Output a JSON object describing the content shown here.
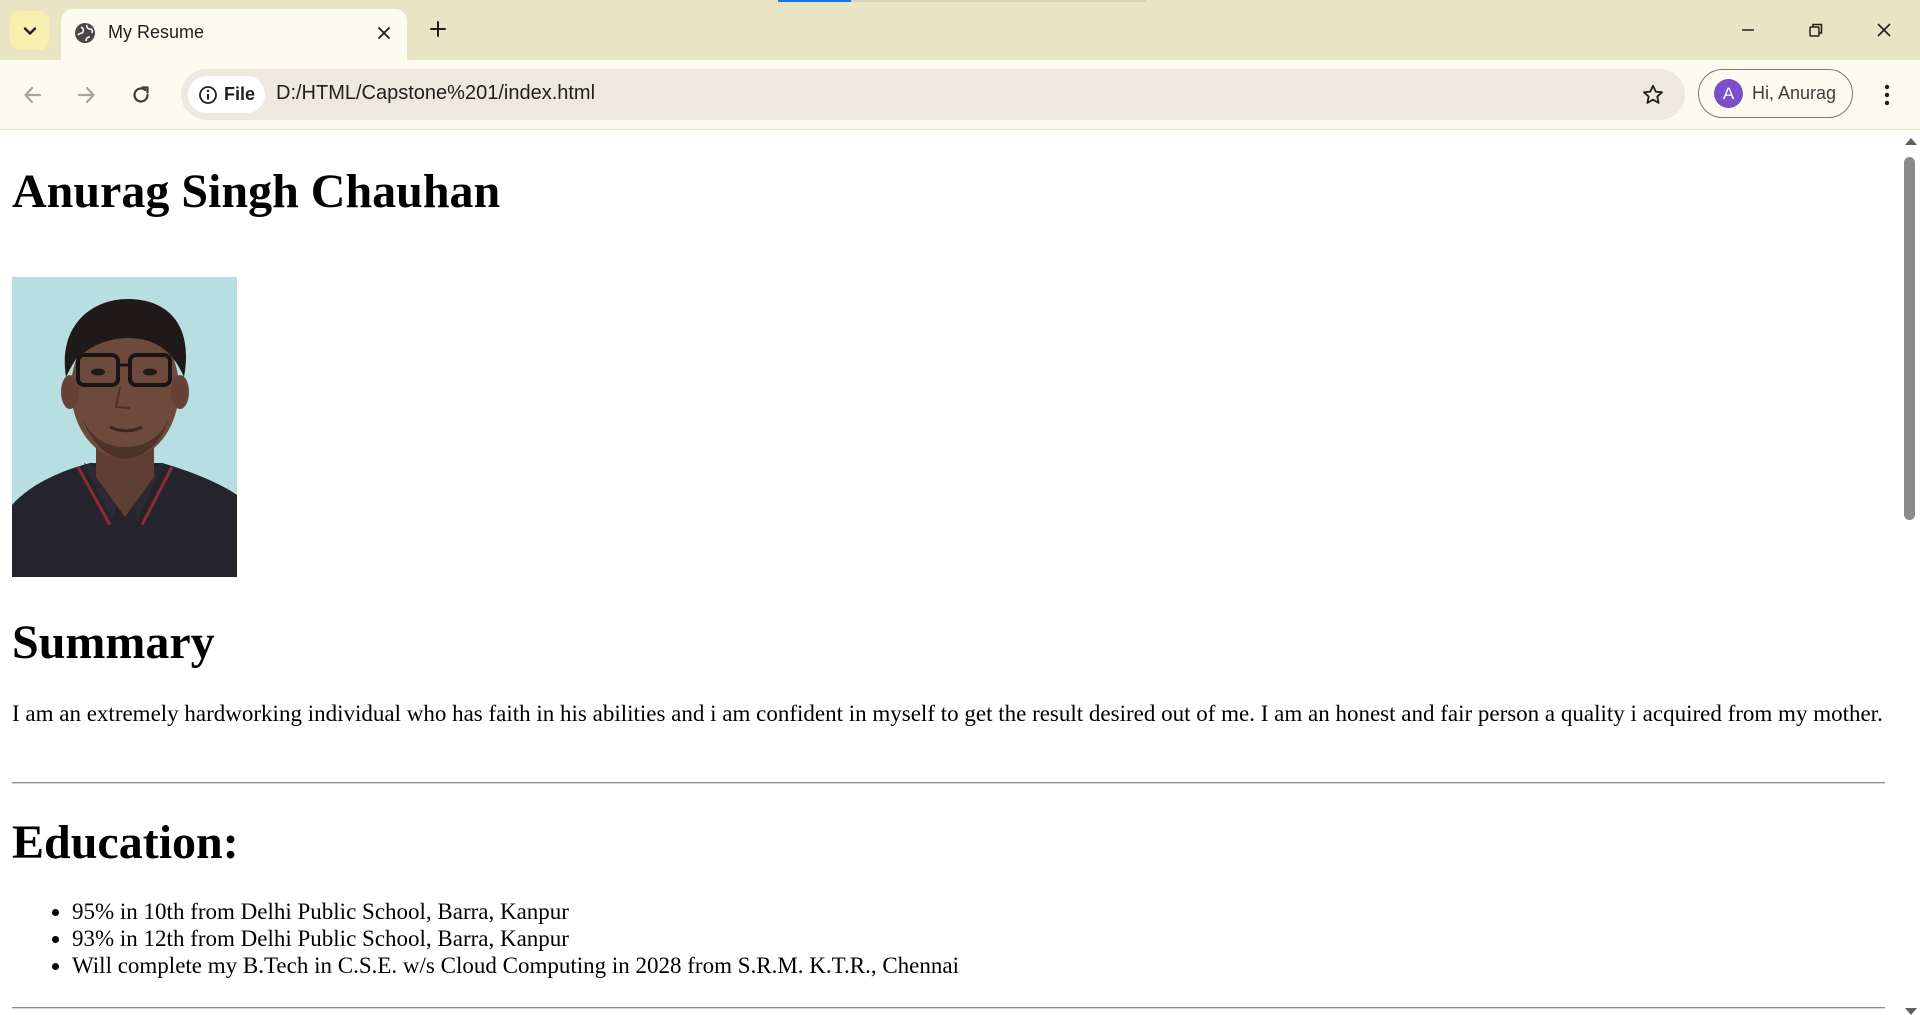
{
  "browser": {
    "tab": {
      "title": "My Resume",
      "favicon": "globe-icon"
    },
    "address_bar": {
      "chip_label": "File",
      "url": "D:/HTML/Capstone%201/index.html"
    },
    "profile": {
      "avatar_initial": "A",
      "name": "Hi, Anurag",
      "avatar_color": "#7b4fc9"
    },
    "colors": {
      "tabstrip": "#e9e4c4",
      "toolbar": "#fdfbf0",
      "omnibox": "#ede9df",
      "tab_search_button": "#f8eeb0"
    },
    "icons": {
      "tab_search": "chevron-down-icon",
      "tab_close": "close-icon",
      "new_tab": "plus-icon",
      "back": "arrow-left-icon",
      "forward": "arrow-right-icon",
      "reload": "reload-icon",
      "site_info": "info-icon",
      "bookmark": "star-icon",
      "menu": "kebab-menu-icon",
      "minimize": "minimize-icon",
      "restore": "restore-icon",
      "close_window": "close-icon"
    }
  },
  "page": {
    "name": "Anurag Singh Chauhan",
    "photo": "profile-photo",
    "summary": {
      "heading": "Summary",
      "text": "I am an extremely hardworking individual who has faith in his abilities and i am confident in myself to get the result desired out of me. I am an honest and fair person a quality i acquired from my mother."
    },
    "education": {
      "heading": "Education:",
      "items": [
        "95% in 10th from Delhi Public School, Barra, Kanpur",
        "93% in 12th from Delhi Public School, Barra, Kanpur",
        "Will complete my B.Tech in C.S.E. w/s Cloud Computing in 2028 from S.R.M. K.T.R., Chennai"
      ]
    }
  }
}
